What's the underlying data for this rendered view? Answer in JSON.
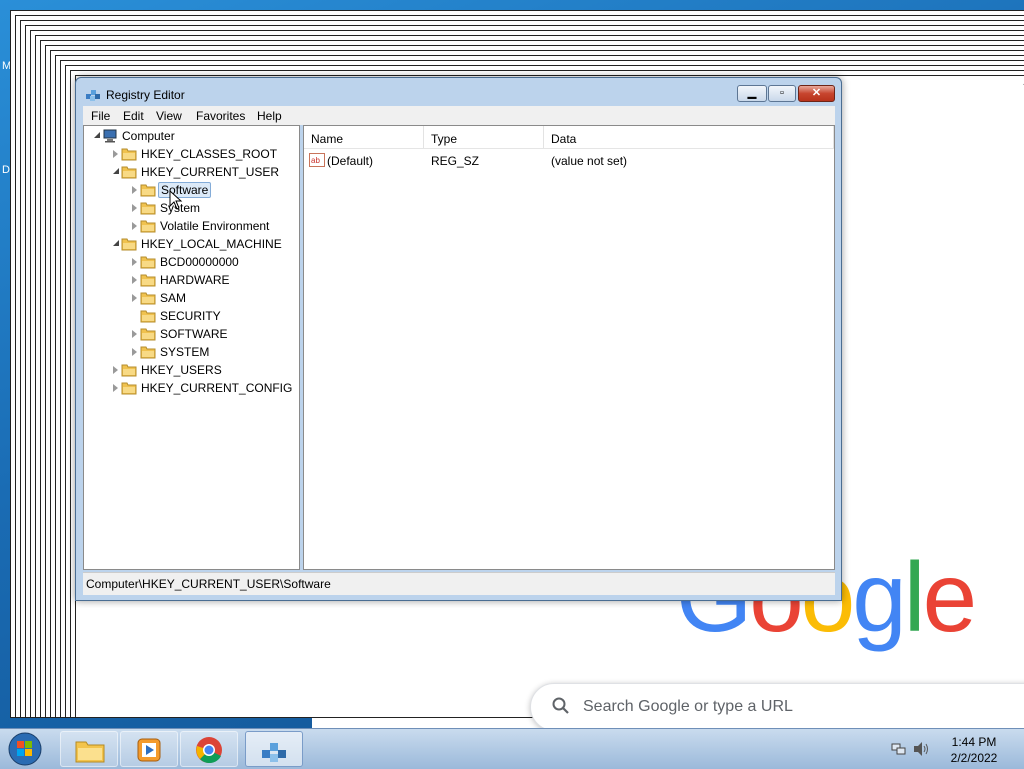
{
  "desktop": {
    "labels": [
      "M",
      "D"
    ]
  },
  "chrome": {
    "logo_letters": [
      "G",
      "o",
      "o",
      "g",
      "l",
      "e"
    ],
    "logo_colors": [
      "#4285f4",
      "#ea4335",
      "#fbbc05",
      "#4285f4",
      "#34a853",
      "#ea4335"
    ],
    "search_placeholder": "Search Google or type a URL"
  },
  "regedit": {
    "title": "Registry Editor",
    "menu": [
      "File",
      "Edit",
      "View",
      "Favorites",
      "Help"
    ],
    "tree": {
      "root": "Computer",
      "hkcr": "HKEY_CLASSES_ROOT",
      "hkcu": "HKEY_CURRENT_USER",
      "hkcu_children": [
        "Software",
        "System",
        "Volatile Environment"
      ],
      "hklm": "HKEY_LOCAL_MACHINE",
      "hklm_children": [
        "BCD00000000",
        "HARDWARE",
        "SAM",
        "SECURITY",
        "SOFTWARE",
        "SYSTEM"
      ],
      "hku": "HKEY_USERS",
      "hkcc": "HKEY_CURRENT_CONFIG",
      "selected": "Software"
    },
    "columns": [
      "Name",
      "Type",
      "Data"
    ],
    "values": [
      {
        "name": "(Default)",
        "type": "REG_SZ",
        "data": "(value not set)"
      }
    ],
    "status": "Computer\\HKEY_CURRENT_USER\\Software"
  },
  "taskbar": {
    "apps": [
      "windows-explorer",
      "media-player",
      "google-chrome",
      "registry-editor"
    ],
    "active_app": "registry-editor",
    "time": "1:44 PM",
    "date": "2/2/2022"
  }
}
